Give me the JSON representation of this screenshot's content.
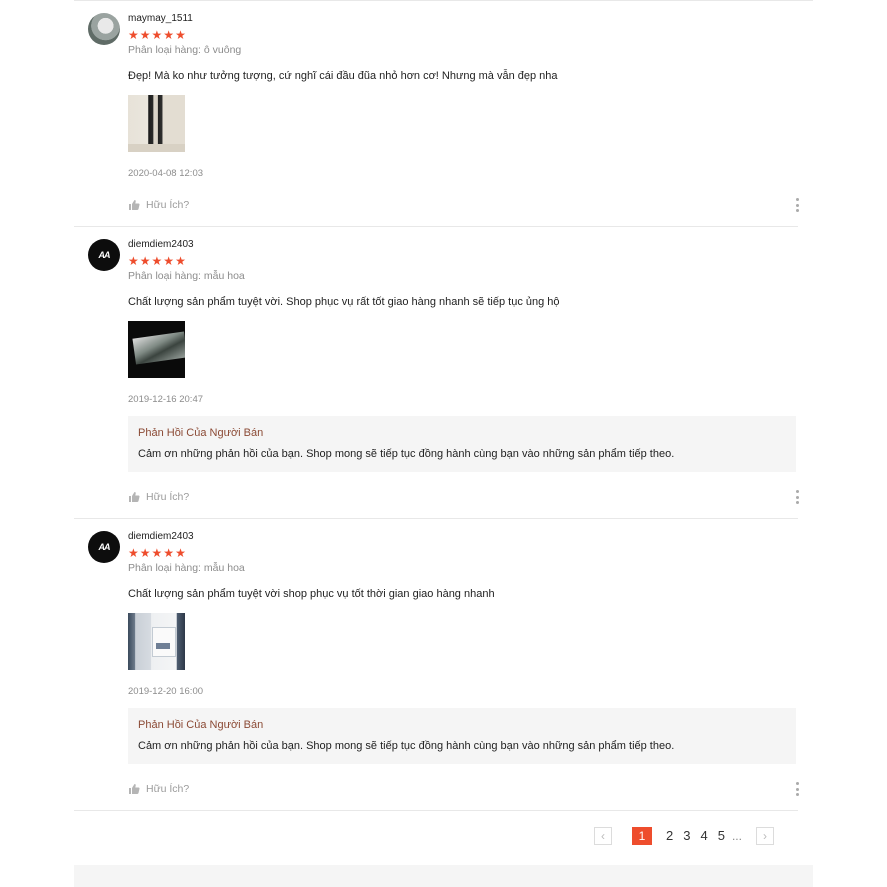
{
  "reviews": [
    {
      "username": "maymay_1511",
      "rating": 5,
      "variation": "Phân loại hàng: ô vuông",
      "comment": "Đẹp! Mà ko như tưởng tượng, cứ nghĩ cái đầu đũa nhỏ hơn cơ! Nhưng mà vẫn đẹp nha",
      "time": "2020-04-08 12:03",
      "helpful_label": "Hữu Ích?"
    },
    {
      "username": "diemdiem2403",
      "avatar_text": "AA",
      "rating": 5,
      "variation": "Phân loại hàng: mẫu hoa",
      "comment": "Chất lượng sản phẩm tuyệt vời. Shop phục vụ rất tốt giao hàng nhanh sẽ tiếp tục ủng hộ",
      "time": "2019-12-16 20:47",
      "reply_title": "Phản Hồi Của Người Bán",
      "reply_text": "Cảm ơn những phản hồi của bạn. Shop mong sẽ tiếp tục đồng hành cùng bạn vào những sản phẩm tiếp theo.",
      "helpful_label": "Hữu Ích?"
    },
    {
      "username": "diemdiem2403",
      "avatar_text": "AA",
      "rating": 5,
      "variation": "Phân loại hàng: mẫu hoa",
      "comment": "Chất lượng sản phẩm tuyệt vời shop phục vụ tốt thời gian giao hàng nhanh",
      "time": "2019-12-20 16:00",
      "reply_title": "Phản Hồi Của Người Bán",
      "reply_text": "Cảm ơn những phản hồi của bạn. Shop mong sẽ tiếp tục đồng hành cùng bạn vào những sản phẩm tiếp theo.",
      "helpful_label": "Hữu Ích?"
    }
  ],
  "star_glyph": "★",
  "pagination": {
    "prev": "‹",
    "current": "1",
    "pages": [
      "2",
      "3",
      "4",
      "5"
    ],
    "ellipsis": "...",
    "next": "›"
  },
  "colors": {
    "accent": "#ee4d2d",
    "reply_title": "#8b4a35",
    "muted": "#8c8c8c"
  }
}
